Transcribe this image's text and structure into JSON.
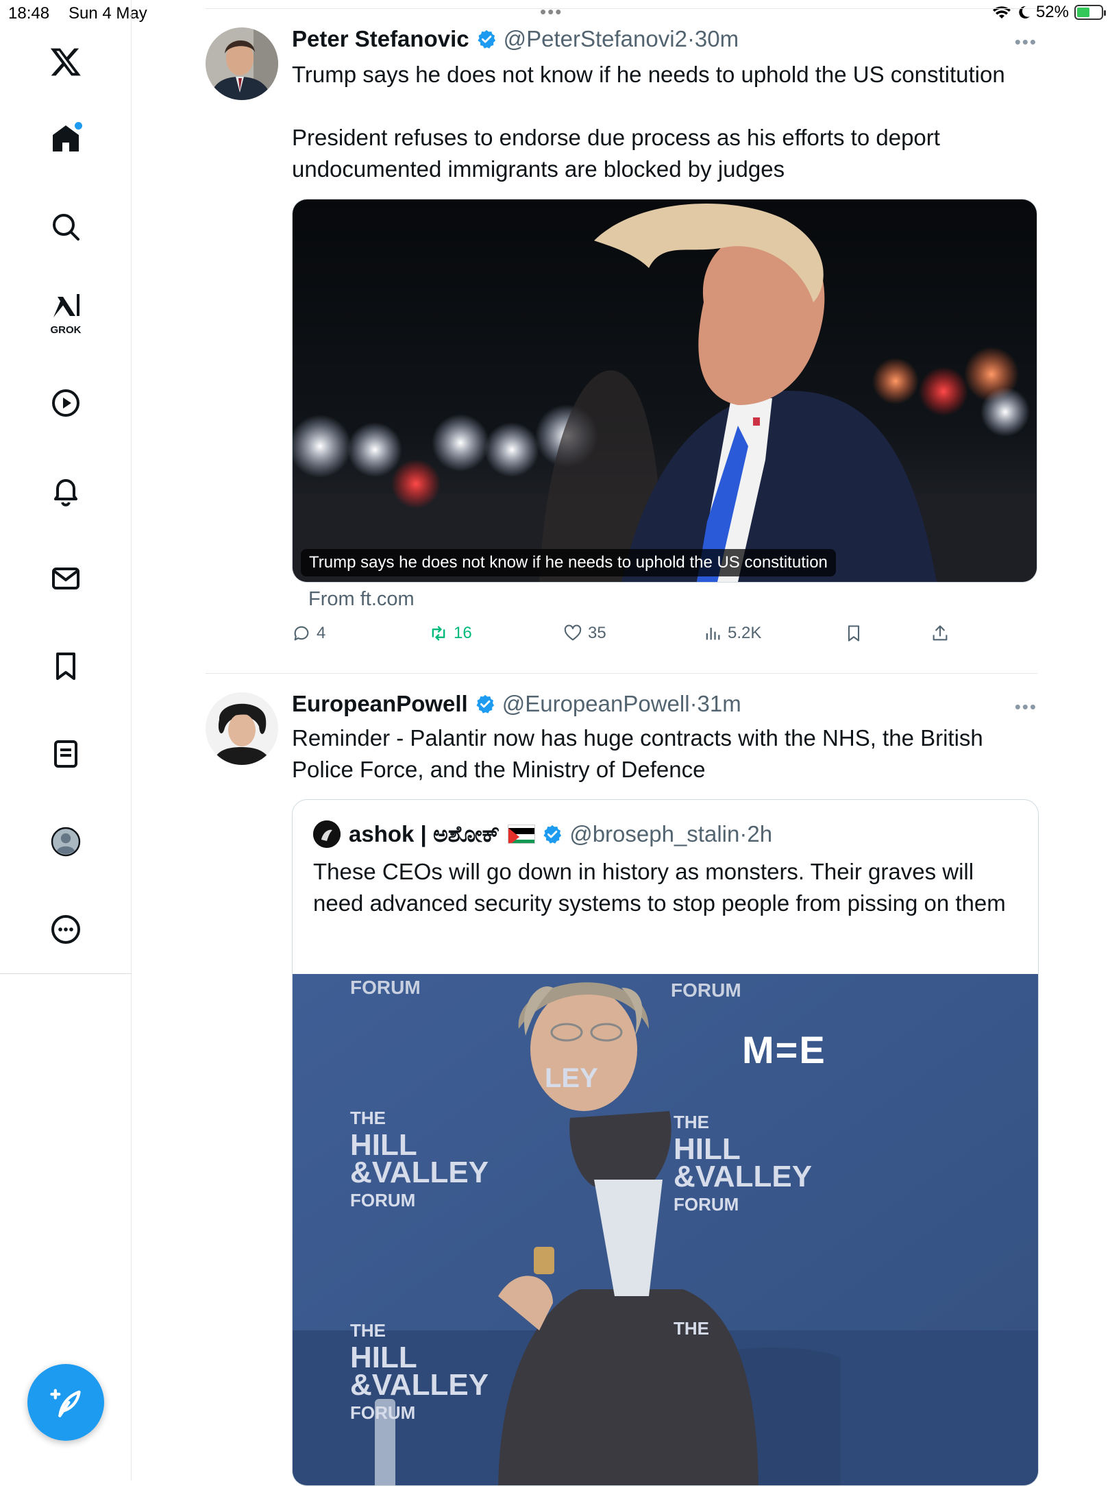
{
  "status_bar": {
    "time": "18:48",
    "date": "Sun 4 May",
    "battery": "52%",
    "battery_level": 0.52
  },
  "sidebar": {
    "grok_label": "GROK",
    "items": [
      "home-icon",
      "search-icon",
      "grok-icon",
      "video-icon",
      "notifications-icon",
      "messages-icon",
      "bookmarks-icon",
      "lists-icon",
      "profile-icon",
      "more-icon"
    ]
  },
  "colors": {
    "accent": "#1d9bf0",
    "retweet_active": "#00ba7c",
    "secondary_text": "#536471"
  },
  "tweets": [
    {
      "name": "Peter Stefanovic",
      "handle": "@PeterStefanovi2",
      "time": "·30m",
      "text": "Trump says he does not know if he needs to uphold the US constitution\n\nPresident refuses to endorse due process as his efforts to deport undocumented immigrants are blocked by judges",
      "media_caption": "Trump says he does not know if he needs to uphold the US constitution",
      "link_source": "From ft.com",
      "stats": {
        "replies": "4",
        "retweets": "16",
        "likes": "35",
        "views": "5.2K"
      }
    },
    {
      "name": "EuropeanPowell",
      "handle": "@EuropeanPowell",
      "time": "·31m",
      "text": "Reminder - Palantir now has huge contracts with the NHS, the British Police Force, and the Ministry of Defence",
      "quote": {
        "name": "ashok | ಅಶೋಕ್",
        "handle": "@broseph_stalin",
        "time": "·2h",
        "text": "These CEOs will go down in history as monsters. Their graves will need advanced security systems to stop people from pissing on them",
        "media_watermark": "M=E",
        "backdrop_text": [
          "THE",
          "HILL",
          "&VALLEY",
          "FORUM",
          "LEY"
        ]
      }
    }
  ]
}
